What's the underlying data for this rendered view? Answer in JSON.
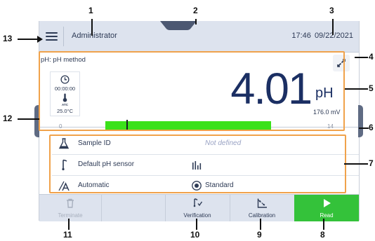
{
  "header": {
    "user": "Administrator",
    "time": "17:46",
    "date": "09/22/2021"
  },
  "method": {
    "name": "pH: pH method"
  },
  "measurement": {
    "timer": "00:00:00",
    "atc_label": "ATC",
    "temperature": "25.0°C",
    "value": "4.01",
    "unit": "pH",
    "millivolts": "176.0 mV",
    "scale_min": "0",
    "scale_max": "14"
  },
  "settings": [
    {
      "icon": "flask-icon",
      "label": "Sample ID",
      "value": "Not defined"
    },
    {
      "icon": "ph-sensor-icon",
      "label": "Default pH sensor",
      "value": ""
    },
    {
      "icon": "auto-endpoint-icon",
      "label": "Automatic",
      "value": "Standard"
    }
  ],
  "actions": {
    "terminate": "Terminate",
    "verification": "Verification",
    "calibration": "Calibration",
    "read": "Read"
  },
  "callouts": [
    "1",
    "2",
    "3",
    "4",
    "5",
    "6",
    "7",
    "8",
    "9",
    "10",
    "11",
    "12",
    "13"
  ],
  "colors": {
    "header_bg": "#dde3ee",
    "value_text": "#1b2f63",
    "scale_bar": "#3be11a",
    "read_button": "#34c23a",
    "highlight_frame": "#f0a24b",
    "placeholder_text": "#9aa3c4"
  }
}
